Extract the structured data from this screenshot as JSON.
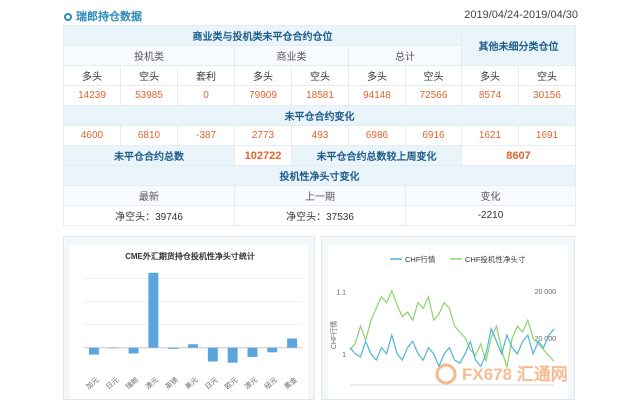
{
  "header": {
    "title": "瑞郎持仓数据",
    "date_range": "2019/04/24-2019/04/30"
  },
  "table": {
    "section1_title": "商业类与投机类未平仓合约仓位",
    "other_title": "其他未细分类仓位",
    "group_labels": [
      "投机类",
      "商业类",
      "总计"
    ],
    "col_labels": [
      "多头",
      "空头",
      "套利",
      "多头",
      "空头",
      "多头",
      "空头",
      "多头",
      "空头"
    ],
    "row1": [
      "14239",
      "53985",
      "0",
      "79909",
      "18581",
      "94148",
      "72566",
      "8574",
      "30156"
    ],
    "change_title": "未平仓合约变化",
    "row2": [
      "4600",
      "6810",
      "-387",
      "2773",
      "493",
      "6986",
      "6916",
      "1621",
      "1691"
    ],
    "total_label": "未平仓合约总数",
    "total_value": "102722",
    "total_change_label": "未平仓合约总数较上周变化",
    "total_change_value": "8607",
    "net_title": "投机性净头寸变化",
    "net_cols": [
      "最新",
      "上一期",
      "变化"
    ],
    "net_vals": [
      "净空头：39746",
      "净空头：37536",
      "-2210"
    ]
  },
  "chart_data": [
    {
      "type": "bar",
      "title": "CME外汇期货持仓投机性净头寸统计",
      "categories": [
        "加元",
        "日元",
        "瑞郎",
        "澳元",
        "英镑",
        "美元",
        "日元",
        "欧元",
        "澳元",
        "纽元",
        "黄金"
      ],
      "values": [
        -0.6,
        0,
        -0.5,
        6.5,
        -0.1,
        0.3,
        -1.2,
        -1.3,
        -0.8,
        -0.4,
        0.8
      ],
      "ylim": [
        -1.5,
        7
      ],
      "grid": true,
      "colors": {
        "bar": "#5aa5de"
      }
    },
    {
      "type": "line",
      "legend": [
        "CHF行情",
        "CHF投机性净头寸"
      ],
      "ylabel": "CHF行情",
      "left_ticks": [
        "1.1",
        "1"
      ],
      "right_ticks": [
        "20 000",
        "-20 000"
      ],
      "y1lim": [
        0.95,
        1.12
      ],
      "y2lim": [
        -60000,
        30000
      ],
      "x": [
        0,
        1,
        2,
        3,
        4,
        5,
        6,
        7,
        8,
        9,
        10,
        11,
        12,
        13,
        14,
        15,
        16,
        17,
        18,
        19,
        20,
        21,
        22,
        23,
        24,
        25,
        26,
        27,
        28,
        29,
        30,
        31,
        32,
        33,
        34,
        35,
        36,
        37,
        38,
        39
      ],
      "series": [
        {
          "name": "CHF行情",
          "color": "#4fb3d9",
          "values": [
            1.01,
            1.0,
            0.995,
            1.02,
            1.0,
            0.99,
            1.01,
            1.0,
            1.03,
            1.0,
            0.99,
            1.01,
            1.02,
            1.0,
            0.99,
            1.01,
            1.0,
            0.98,
            1.0,
            1.01,
            0.99,
            0.985,
            1.0,
            1.02,
            0.99,
            0.98,
            1.0,
            1.04,
            1.02,
            1.0,
            1.03,
            1.01,
            1.0,
            1.02,
            1.03,
            1.0,
            1.02,
            1.01,
            1.03,
            1.04
          ]
        },
        {
          "name": "CHF投机性净头寸",
          "color": "#8bd36a",
          "values": [
            -30000,
            -25000,
            -10000,
            -22000,
            -5000,
            5000,
            15000,
            10000,
            20000,
            8000,
            -2000,
            2000,
            -5000,
            10000,
            5000,
            15000,
            -5000,
            0,
            10000,
            5000,
            -10000,
            -15000,
            -20000,
            -30000,
            -35000,
            -25000,
            -40000,
            -20000,
            -10000,
            -30000,
            -45000,
            -20000,
            -10000,
            -15000,
            -5000,
            -20000,
            -25000,
            -30000,
            -35000,
            -40000
          ]
        }
      ],
      "watermark": "FX678 汇通网",
      "colors": {
        "chf": "#4fb3d9",
        "net": "#8bd36a"
      }
    }
  ]
}
